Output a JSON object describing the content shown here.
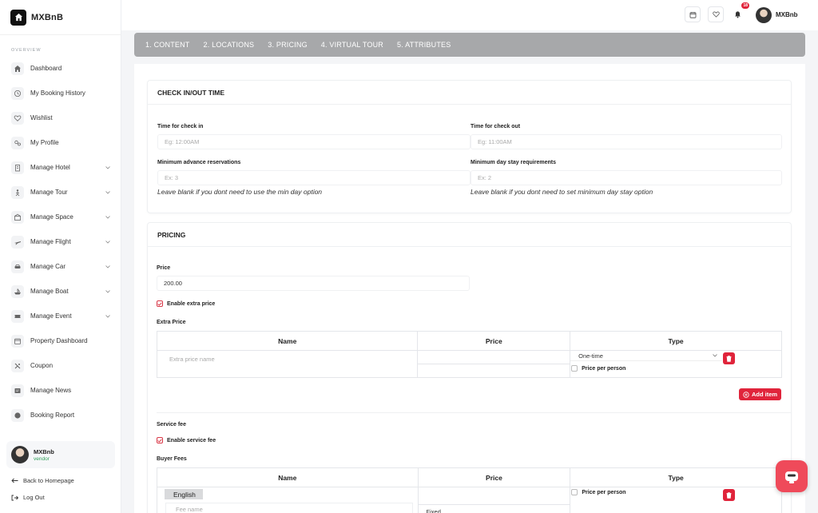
{
  "brand": {
    "name": "MXBnB"
  },
  "sidebar": {
    "section": "OVERVIEW",
    "items": [
      {
        "label": "Dashboard",
        "icon": "home-icon",
        "chevron": false
      },
      {
        "label": "My Booking History",
        "icon": "clock-icon",
        "chevron": false
      },
      {
        "label": "Wishlist",
        "icon": "heart-icon",
        "chevron": false
      },
      {
        "label": "My Profile",
        "icon": "gear-icon",
        "chevron": false
      },
      {
        "label": "Manage Hotel",
        "icon": "building-icon",
        "chevron": true
      },
      {
        "label": "Manage Tour",
        "icon": "tour-icon",
        "chevron": true
      },
      {
        "label": "Manage Space",
        "icon": "space-icon",
        "chevron": true
      },
      {
        "label": "Manage Flight",
        "icon": "plane-icon",
        "chevron": true
      },
      {
        "label": "Manage Car",
        "icon": "car-icon",
        "chevron": true
      },
      {
        "label": "Manage Boat",
        "icon": "boat-icon",
        "chevron": true
      },
      {
        "label": "Manage Event",
        "icon": "ticket-icon",
        "chevron": true
      },
      {
        "label": "Property Dashboard",
        "icon": "calendar-icon",
        "chevron": false
      },
      {
        "label": "Coupon",
        "icon": "coupon-icon",
        "chevron": false
      },
      {
        "label": "Manage News",
        "icon": "news-icon",
        "chevron": false
      },
      {
        "label": "Booking Report",
        "icon": "report-icon",
        "chevron": false
      }
    ],
    "user": {
      "name": "MXBnb",
      "role": "vendor"
    },
    "back_home": "Back to Homepage",
    "logout": "Log Out"
  },
  "topbar": {
    "user_name": "MXBnb",
    "notification_count": "18"
  },
  "tabs": [
    {
      "label": "1. CONTENT",
      "active": false
    },
    {
      "label": "2. LOCATIONS",
      "active": false
    },
    {
      "label": "3. PRICING",
      "active": true
    },
    {
      "label": "4. VIRTUAL TOUR",
      "active": false
    },
    {
      "label": "5. ATTRIBUTES",
      "active": false
    }
  ],
  "checkin": {
    "title": "CHECK IN/OUT TIME",
    "checkin_label": "Time for check in",
    "checkin_placeholder": "Eg: 12:00AM",
    "checkout_label": "Time for check out",
    "checkout_placeholder": "Eg: 11:00AM",
    "min_adv_label": "Minimum advance reservations",
    "min_adv_placeholder": "Ex: 3",
    "min_adv_hint": "Leave blank if you dont need to use the min day option",
    "min_stay_label": "Minimum day stay requirements",
    "min_stay_placeholder": "Ex: 2",
    "min_stay_hint": "Leave blank if you dont need to set minimum day stay option"
  },
  "pricing": {
    "title": "PRICING",
    "price_label": "Price",
    "price_value": "200.00",
    "enable_extra": "Enable extra price",
    "extra_label": "Extra Price",
    "columns": [
      "Name",
      "Price",
      "Type"
    ],
    "extra_name_placeholder": "Extra price name",
    "extra_type_value": "One-time",
    "price_per_person": "Price per person",
    "add_item": "Add item",
    "service_fee_label": "Service fee",
    "enable_service": "Enable service fee",
    "buyer_fees_label": "Buyer Fees",
    "lang_tab": "English",
    "fee_name_placeholder": "Fee name",
    "fee_type_value": "Fixed"
  },
  "colors": {
    "accent": "#e0243b",
    "tab_bar": "#a7a8aa",
    "float_button": "#ef4a5a"
  }
}
